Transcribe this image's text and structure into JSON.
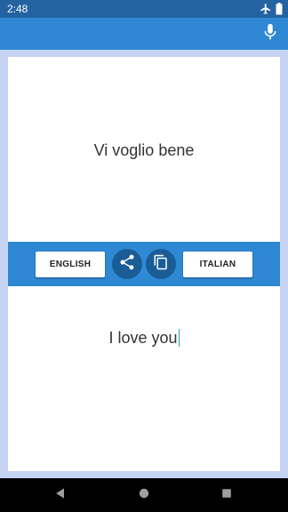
{
  "status_bar": {
    "time": "2:48",
    "icons": [
      "airplane-icon",
      "battery-icon"
    ]
  },
  "app_bar": {
    "action_icon": "microphone-icon"
  },
  "source": {
    "text": "Vi voglio bene"
  },
  "translation": {
    "text": "I love you"
  },
  "controls": {
    "left_language": "ENGLISH",
    "right_language": "ITALIAN",
    "share_icon": "share-icon",
    "copy_icon": "copy-icon"
  },
  "nav_bar": {
    "icons": [
      "back-icon",
      "home-icon",
      "recents-icon"
    ]
  },
  "colors": {
    "status_bar": "#2463a1",
    "app_bar": "#2e88d4",
    "accent_round_button": "#1a5c96",
    "background": "#c5d3f3",
    "caret": "#1fa3a3"
  }
}
